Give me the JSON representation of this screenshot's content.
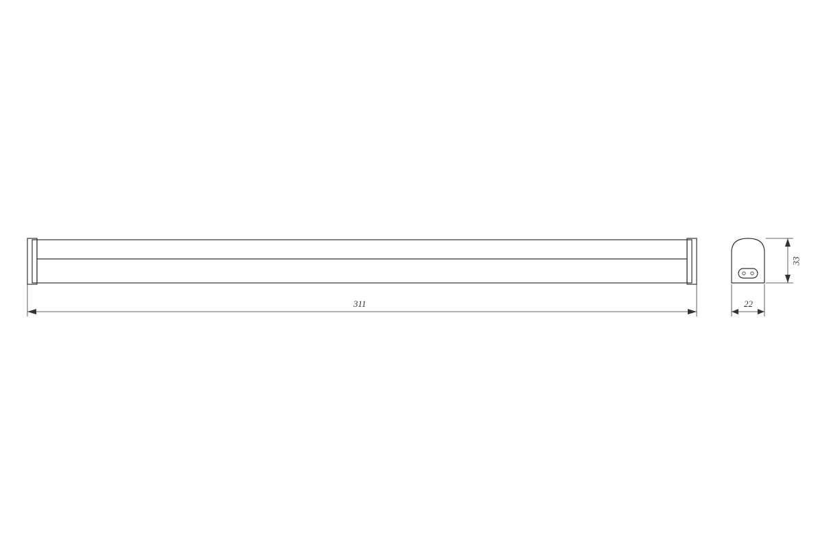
{
  "drawing": {
    "type": "technical-dimension-drawing",
    "units": "mm",
    "object": "linear-fixture",
    "dimensions": {
      "length": "311",
      "width": "22",
      "height": "33"
    }
  }
}
